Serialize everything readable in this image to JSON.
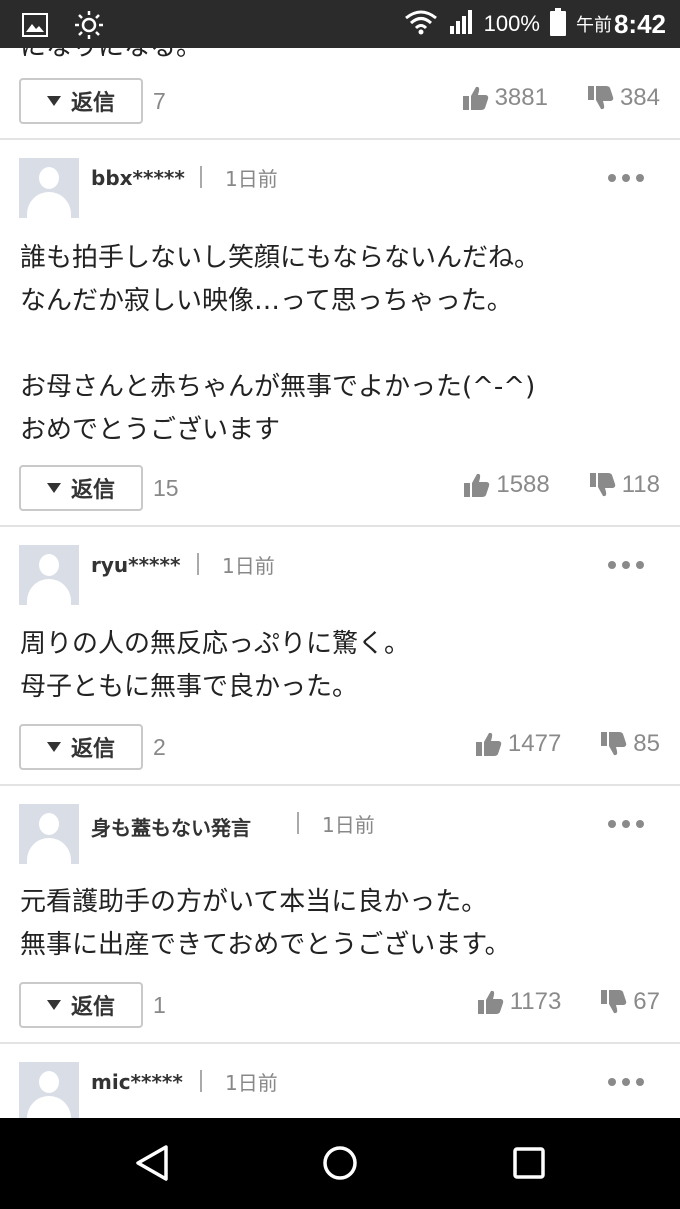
{
  "status_bar": {
    "battery": "100%",
    "ampm": "午前",
    "time": "8:42"
  },
  "top_partial": {
    "text": "になりになる。",
    "reply_label": "返信",
    "reply_count": "7",
    "likes": "3881",
    "dislikes": "384"
  },
  "comments": [
    {
      "user": "bbx*****",
      "time": "1日前",
      "lines": [
        "誰も拍手しないし笑顔にもならないんだね。",
        "なんだか寂しい映像…って思っちゃった。",
        "",
        "お母さんと赤ちゃんが無事でよかった(^-^)",
        "おめでとうございます"
      ],
      "reply_label": "返信",
      "reply_count": "15",
      "likes": "1588",
      "dislikes": "118"
    },
    {
      "user": "ryu*****",
      "time": "1日前",
      "lines": [
        "周りの人の無反応っぷりに驚く。",
        "母子ともに無事で良かった。"
      ],
      "reply_label": "返信",
      "reply_count": "2",
      "likes": "1477",
      "dislikes": "85"
    },
    {
      "user": "身も蓋もない発言",
      "time": "1日前",
      "lines": [
        "元看護助手の方がいて本当に良かった。",
        "無事に出産できておめでとうございます。"
      ],
      "reply_label": "返信",
      "reply_count": "1",
      "likes": "1173",
      "dislikes": "67"
    },
    {
      "user": "mic*****",
      "time": "1日前"
    }
  ],
  "icons": {
    "gallery": "image-icon",
    "brightness": "sun-icon",
    "wifi": "wifi-icon",
    "signal": "signal-icon",
    "battery": "battery-icon",
    "like": "thumbs-up-icon",
    "dislike": "thumbs-down-icon",
    "more": "more-dots-icon",
    "back": "back-triangle-icon",
    "home": "home-circle-icon",
    "recents": "recents-square-icon"
  },
  "colors": {
    "status_bar": "#2b2b2b",
    "nav_bar": "#000000",
    "muted": "#8a8a8a",
    "avatar": "#d8dde6"
  }
}
